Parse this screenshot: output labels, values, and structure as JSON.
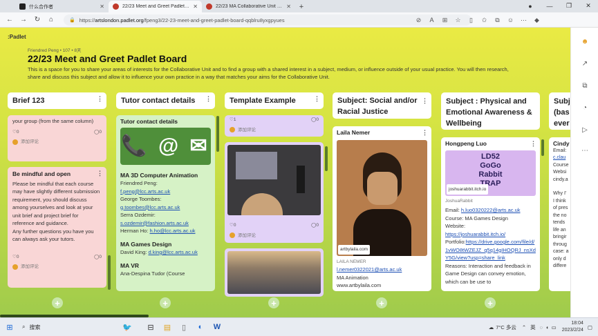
{
  "browser": {
    "tabs": [
      {
        "label": "什么合作者",
        "active": false,
        "color": "#222"
      },
      {
        "label": "22/23 Meet and Greet Padlet Bo...",
        "active": true,
        "color": "#c0392b"
      },
      {
        "label": "22/23 MA Collaborative Unit pr...",
        "active": false,
        "color": "#c0392b"
      }
    ],
    "url_prefix": "https://",
    "url_host": "artslondon.padlet.org",
    "url_path": "/fpeng3/22-23-meet-and-greet-padlet-board-qqblru8yxgpyues"
  },
  "board": {
    "logo": ":Padlet",
    "meta": "Friendred Peng  •  107  •  8天",
    "title": "22/23 Meet and Greet Padlet Board",
    "description": "This is a space for you to share your areas of interests for the Collaborative Unit and to find a group with a shared interest in a subject, medium, or influence outside of your usual practice. You will then research, share and discuss this subject and allow it to influence your own practice in a way that matches your aims for the Collaborative Unit."
  },
  "columns": [
    {
      "title": "Brief 123"
    },
    {
      "title": "Tutor contact details"
    },
    {
      "title": "Template Example"
    },
    {
      "title": "Subject: Social and/or Racial Justice"
    },
    {
      "title": "Subject : Physical and Emotional Awareness & Wellbeing"
    },
    {
      "title": "Subj (bas ever"
    }
  ],
  "col1": {
    "card1_text": "your group (from the same column)",
    "card1_likes": "0",
    "card1_comments": "0",
    "card1_add_comment": "添加评论",
    "card2_title": "Be mindful and open",
    "card2_text": "Please be mindful that each course may have slightly different submission requirement, you should discuss among yourselves and look at your unit brief and project brief for reference and guidance.",
    "card2_text2": "Any further questions you have you can always ask your tutors.",
    "card2_likes": "0",
    "card2_comments": "0",
    "card2_add_comment": "添加评论"
  },
  "col2": {
    "card_title": "Tutor contact details",
    "icon_symbols": "📞 @ ✉",
    "section1": "MA 3D Computer Animation",
    "s1_l1": "Friendred Peng:",
    "s1_l2": "f.peng@lcc.arts.ac.uk",
    "s1_l3": "George Toombes:",
    "s1_l4": "g.toombes@lcc.arts.ac.uk",
    "s1_l5": "Serra Ozdemir:",
    "s1_l6": "s.ozdemir@fashion.arts.ac.uk",
    "s1_l7": "Herman Ho: ",
    "s1_l8": "h.ho@lcc.arts.ac.uk",
    "section2": "MA Games Design",
    "s2_l1": "David King: ",
    "s2_l2": "d.king@lcc.arts.ac.uk",
    "section3": "MA VR",
    "s3_l1": "Ana-Despina Tudor (Course"
  },
  "col3": {
    "card1_likes": "1",
    "card1_comments": "0",
    "card1_add_comment": "添加评论",
    "card2_likes": "0",
    "card2_comments": "0",
    "card2_add_comment": "添加评论"
  },
  "col4": {
    "card_title": "Laila Nemer",
    "image_caption": "artbylaila.com",
    "author": "LAILA NEMER",
    "email": "l.nemer0322021@arts.ac.uk",
    "course": "MA Animation",
    "site": "www.artbylaila.com"
  },
  "col5": {
    "card_title": "Hongpeng Luo",
    "banner_line1": "LD52",
    "banner_line2": "GoGo",
    "banner_line3": "Rabbit",
    "banner_line4": "TRAP",
    "link_host": "joshuarabbit.itch.io",
    "link_name": "JoshuaRabbit",
    "email_label": "Email: ",
    "email": "h.luo0320222@arts.ac.uk",
    "course": "Course: MA Games Design",
    "website_label": "Website:",
    "website": "https://joshuarabbit.itch.io/",
    "portfolio_label": "Portfolio:",
    "portfolio": "https://drive.google.com/file/d/1vWO8tWZEJZ_q5q14gIHOQRJ_nsXdY5G/view?usp=share_link",
    "reasons": "Reasons: Interaction and feedback in Game Design can convey emotion, which can be use to"
  },
  "col6": {
    "card_title": "Cindy",
    "lines": [
      "Email:",
      "c.clau",
      "Course",
      "Websi",
      "cindy.a",
      "",
      "Why I'",
      "I think",
      "of pres",
      "the no",
      "tends",
      "life an",
      "bringir",
      "throug",
      "case: a",
      "only d",
      "differe"
    ]
  },
  "taskbar": {
    "search": "搜索",
    "weather": "7°C 多云",
    "ime": "英",
    "time": "18:04",
    "date": "2023/2/24"
  },
  "colors": {
    "bg_top": "#eaea44",
    "bg_bottom": "#9fcb4c",
    "pink_card": "#f9d6d6",
    "green_card": "#d6f2c6",
    "purple_card": "#e2d2f7"
  }
}
